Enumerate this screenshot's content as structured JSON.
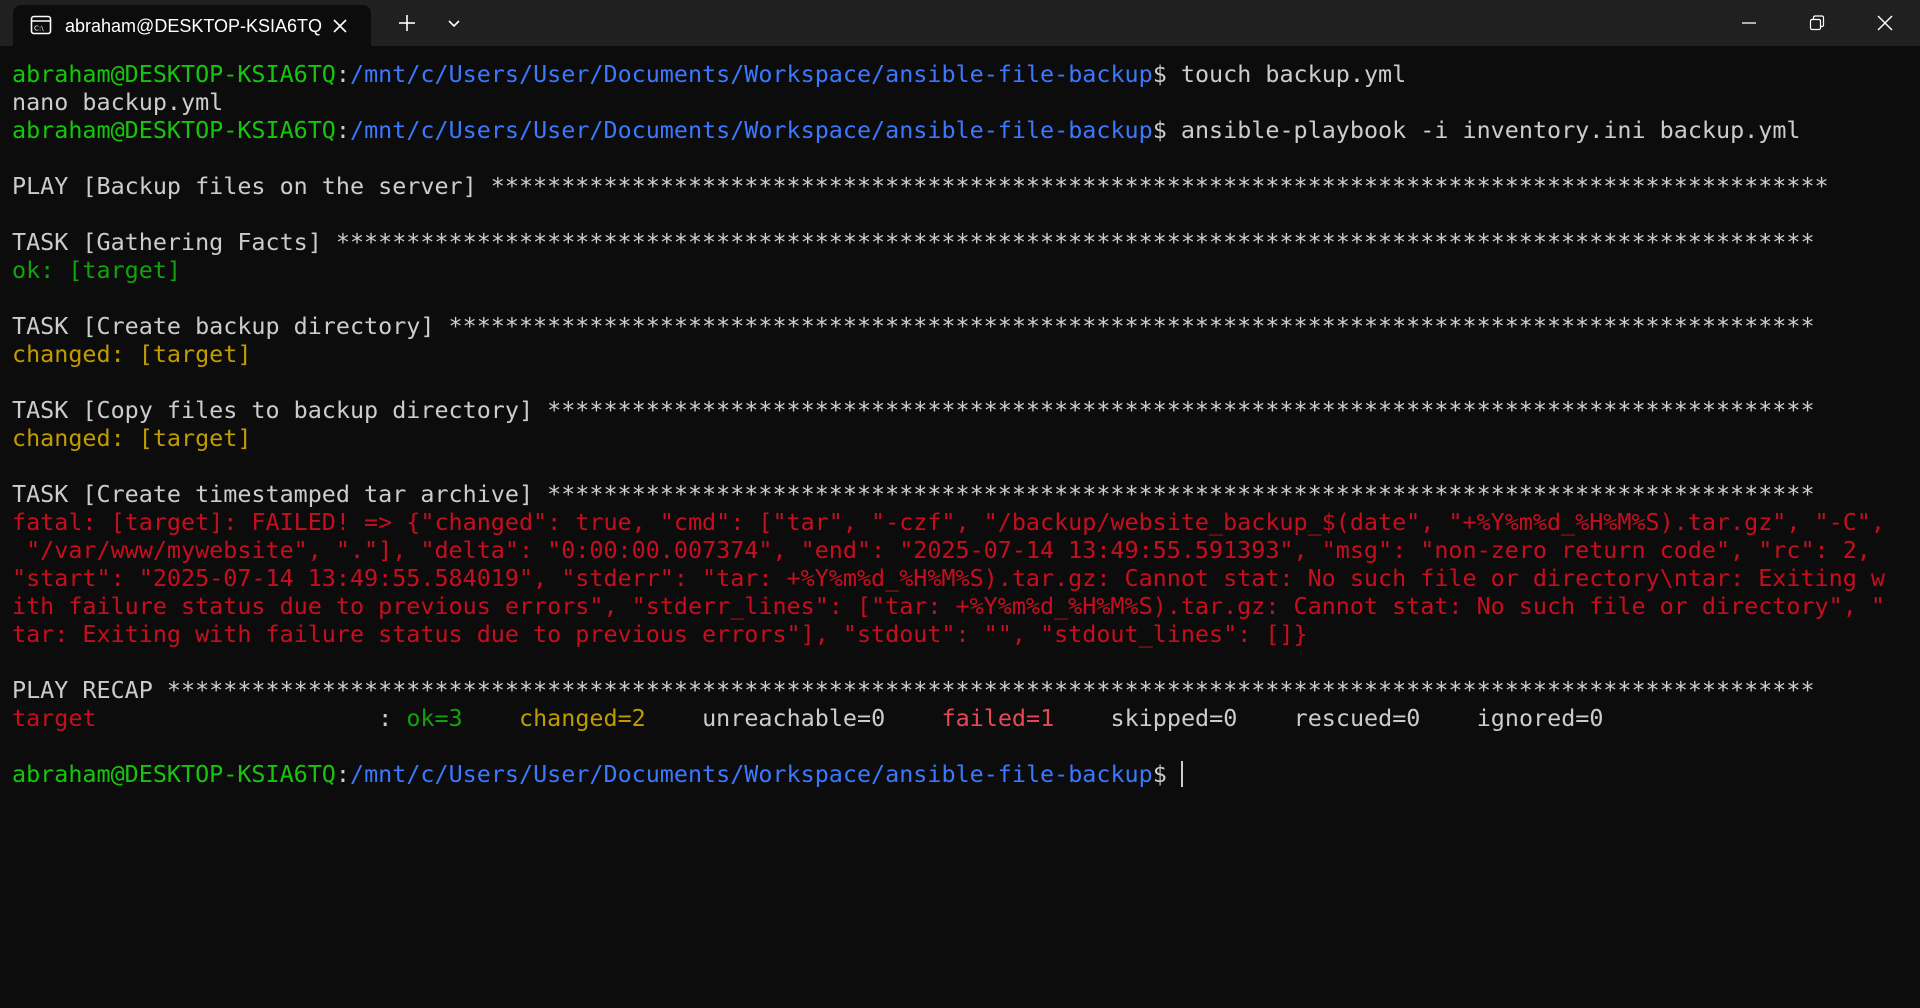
{
  "window": {
    "tab_title": "abraham@DESKTOP-KSIA6TQ",
    "tab_icon": "terminal-icon",
    "controls": [
      "minimize-icon",
      "restore-icon",
      "close-icon"
    ]
  },
  "colors": {
    "background": "#0c0c0c",
    "titlebar": "#202020",
    "prompt_user": "#16c60c",
    "prompt_path": "#3b78ff",
    "ok": "#13a10e",
    "changed": "#c19c00",
    "failed": "#e74856",
    "fatal": "#c50f1f"
  },
  "prompt": {
    "user": "abraham@DESKTOP-KSIA6TQ",
    "sep": ":",
    "path": "/mnt/c/Users/User/Documents/Workspace/ansible-file-backup",
    "symbol": "$ "
  },
  "session": {
    "cmd1": "touch backup.yml",
    "out1": "nano backup.yml",
    "cmd2": "ansible-playbook -i inventory.ini backup.yml",
    "play": "PLAY [Backup files on the server] ***********************************************************************************************",
    "task1": "TASK [Gathering Facts] *********************************************************************************************************",
    "task1_result": "ok: [target]",
    "task2": "TASK [Create backup directory] *************************************************************************************************",
    "task2_result": "changed: [target]",
    "task3": "TASK [Copy files to backup directory] ******************************************************************************************",
    "task3_result": "changed: [target]",
    "task4": "TASK [Create timestamped tar archive] ******************************************************************************************",
    "fatal_lines": [
      "fatal: [target]: FAILED! => {\"changed\": true, \"cmd\": [\"tar\", \"-czf\", \"/backup/website_backup_$(date\", \"+%Y%m%d_%H%M%S).tar.gz\", \"-C\",",
      " \"/var/www/mywebsite\", \".\"], \"delta\": \"0:00:00.007374\", \"end\": \"2025-07-14 13:49:55.591393\", \"msg\": \"non-zero return code\", \"rc\": 2,",
      "\"start\": \"2025-07-14 13:49:55.584019\", \"stderr\": \"tar: +%Y%m%d_%H%M%S).tar.gz: Cannot stat: No such file or directory\\ntar: Exiting w",
      "ith failure status due to previous errors\", \"stderr_lines\": [\"tar: +%Y%m%d_%H%M%S).tar.gz: Cannot stat: No such file or directory\", \"",
      "tar: Exiting with failure status due to previous errors\"], \"stdout\": \"\", \"stdout_lines\": []}"
    ],
    "recap": "PLAY RECAP *********************************************************************************************************************",
    "recap_row": {
      "host": "target",
      "pad1": "                    : ",
      "ok": "ok=3",
      "pad2": "    ",
      "changed": "changed=2",
      "pad3": "    ",
      "unreachable": "unreachable=0",
      "pad4": "    ",
      "failed": "failed=1",
      "pad5": "    ",
      "skipped": "skipped=0",
      "pad6": "    ",
      "rescued": "rescued=0",
      "pad7": "    ",
      "ignored": "ignored=0"
    }
  }
}
